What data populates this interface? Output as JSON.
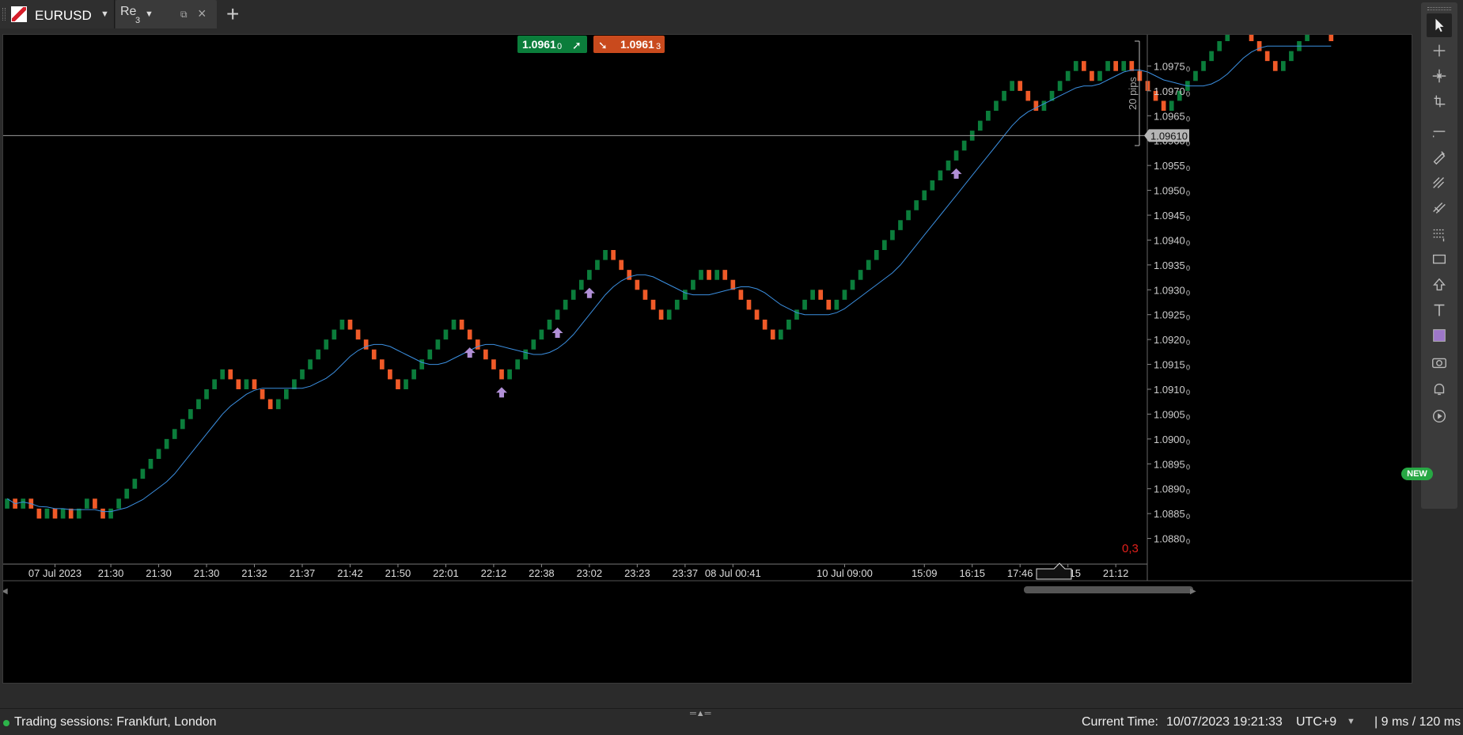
{
  "tabs": {
    "main": {
      "symbol": "EURUSD"
    },
    "second": {
      "label": "Re",
      "sub": "3"
    }
  },
  "quotes": {
    "bid": {
      "price": "1.0961",
      "sub": "0",
      "color": "#0b7d3b"
    },
    "ask": {
      "price": "1.0961",
      "sub": "3",
      "color": "#d2501f"
    }
  },
  "chart": {
    "symbol": "EURUSD",
    "type": "renko",
    "current_price_label": "1.09610",
    "ruler_label": "20 pips",
    "spread_value": "0,3",
    "colors": {
      "bull": "#0b7d3b",
      "bear": "#f05a28",
      "ma": "#3b8fe0",
      "signal": "#b18fd6",
      "spread": "#e3201b"
    },
    "y_axis": {
      "min": 1.0875,
      "max": 1.098,
      "ticks": [
        {
          "value": 1.0975,
          "label": "1.0975",
          "sub": "0"
        },
        {
          "value": 1.097,
          "label": "1.0970",
          "sub": "0"
        },
        {
          "value": 1.0965,
          "label": "1.0965",
          "sub": "0"
        },
        {
          "value": 1.096,
          "label": "1.0960",
          "sub": "0"
        },
        {
          "value": 1.0955,
          "label": "1.0955",
          "sub": "0"
        },
        {
          "value": 1.095,
          "label": "1.0950",
          "sub": "0"
        },
        {
          "value": 1.0945,
          "label": "1.0945",
          "sub": "0"
        },
        {
          "value": 1.094,
          "label": "1.0940",
          "sub": "0"
        },
        {
          "value": 1.0935,
          "label": "1.0935",
          "sub": "0"
        },
        {
          "value": 1.093,
          "label": "1.0930",
          "sub": "0"
        },
        {
          "value": 1.0925,
          "label": "1.0925",
          "sub": "0"
        },
        {
          "value": 1.092,
          "label": "1.0920",
          "sub": "0"
        },
        {
          "value": 1.0915,
          "label": "1.0915",
          "sub": "0"
        },
        {
          "value": 1.091,
          "label": "1.0910",
          "sub": "0"
        },
        {
          "value": 1.0905,
          "label": "1.0905",
          "sub": "0"
        },
        {
          "value": 1.09,
          "label": "1.0900",
          "sub": "0"
        },
        {
          "value": 1.0895,
          "label": "1.0895",
          "sub": "0"
        },
        {
          "value": 1.089,
          "label": "1.0890",
          "sub": "0"
        },
        {
          "value": 1.0885,
          "label": "1.0885",
          "sub": "0"
        },
        {
          "value": 1.088,
          "label": "1.0880",
          "sub": "0"
        }
      ]
    },
    "x_axis": {
      "labels": [
        {
          "brick": 6,
          "label": "07 Jul 2023"
        },
        {
          "brick": 13,
          "label": "21:30"
        },
        {
          "brick": 19,
          "label": "21:30"
        },
        {
          "brick": 25,
          "label": "21:30"
        },
        {
          "brick": 31,
          "label": "21:32"
        },
        {
          "brick": 37,
          "label": "21:37"
        },
        {
          "brick": 43,
          "label": "21:42"
        },
        {
          "brick": 49,
          "label": "21:50"
        },
        {
          "brick": 55,
          "label": "22:01"
        },
        {
          "brick": 61,
          "label": "22:12"
        },
        {
          "brick": 67,
          "label": "22:38"
        },
        {
          "brick": 73,
          "label": "23:02"
        },
        {
          "brick": 79,
          "label": "23:23"
        },
        {
          "brick": 85,
          "label": "23:37"
        },
        {
          "brick": 91,
          "label": "08 Jul 00:41"
        },
        {
          "brick": 105,
          "label": "10 Jul 09:00"
        },
        {
          "brick": 115,
          "label": "15:09"
        },
        {
          "brick": 121,
          "label": "16:15"
        },
        {
          "brick": 127,
          "label": "17:46"
        },
        {
          "brick": 133,
          "label": "19:15"
        },
        {
          "brick": 139,
          "label": "21:12"
        }
      ]
    }
  },
  "chart_data": {
    "type": "renko",
    "brick_size": 0.0002,
    "start_open": 1.0886,
    "directions": "UDUDDUDUDUUDDUUUUUUUUUUUUUUUDDUDDDUUUUUUUUUDDDDDDDUUUUUUUDDDDDDUUUUUUUUUUUUUDDDDDDDUUUUUDUDDDDDDDUUUUUDDUUUUUUUUUUUUUUUUUUUUUUUDDDUUUUUDDUUDUDDDDDUUUUUUUUUDDDDDUUUUUDD",
    "signals_brick_index": [
      58,
      62,
      69,
      73,
      119
    ],
    "ma_period": 10,
    "ylim": [
      1.0875,
      1.098
    ]
  },
  "toolbar": {
    "items": [
      "cursor-icon",
      "crosshair-icon",
      "zoom-icon",
      "measure-icon",
      "line-icon",
      "pen-icon",
      "fib-icon",
      "channel-icon",
      "levels-icon",
      "rectangle-icon",
      "arrow-icon",
      "text-icon",
      "color-icon",
      "camera-icon",
      "bell-icon",
      "replay-icon"
    ],
    "new_badge": "NEW"
  },
  "status": {
    "sessions": "Trading sessions: Frankfurt, London",
    "current_time_label": "Current Time:",
    "current_time_value": "10/07/2023 19:21:33",
    "timezone": "UTC+9",
    "latency": "| 9 ms / 120 ms"
  }
}
